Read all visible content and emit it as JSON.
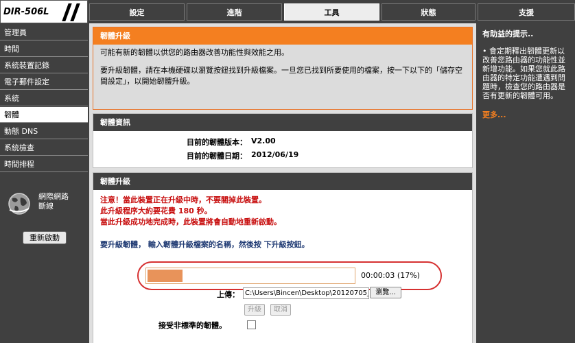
{
  "brand": {
    "model": "DIR-506L"
  },
  "nav": {
    "tabs": [
      {
        "label": "設定"
      },
      {
        "label": "進階"
      },
      {
        "label": "工具"
      },
      {
        "label": "狀態"
      },
      {
        "label": "支援"
      }
    ],
    "active_tab": "工具"
  },
  "sidebar": {
    "items": [
      {
        "label": "管理員"
      },
      {
        "label": "時間"
      },
      {
        "label": "系統裝置記錄"
      },
      {
        "label": "電子郵件設定"
      },
      {
        "label": "系統"
      },
      {
        "label": "韌體"
      },
      {
        "label": "動態 DNS"
      },
      {
        "label": "系統檢查"
      },
      {
        "label": "時間排程"
      }
    ],
    "active_item": "韌體",
    "network_status": "網際網路\n斷線",
    "network_icon": "globe-network-icon",
    "reboot_label": "重新啟動"
  },
  "intro": {
    "title": "韌體升級",
    "line1": "可能有新的韌體以供您的路由器改善功能性與效能之用。",
    "line2": "要升級韌體，請在本機硬碟以瀏覽按鈕找到升級檔案。一旦您已找到所要使用的檔案，按一下以下的「儲存空間設定」，以開始韌體升級。"
  },
  "firmware_info": {
    "title": "韌體資訊",
    "version_label": "目前的韌體版本：",
    "version_value": "V2.00",
    "date_label": "目前的韌體日期：",
    "date_value": "2012/06/19"
  },
  "upgrade": {
    "title": "韌體升級",
    "warning1": "注意！當此裝置正在升級中時，不要關掉此裝置。",
    "warning2": "此升級程序大約要花費 180 秒。",
    "warning3": "當此升級成功地完成時，此裝置將會自動地重新啟動。",
    "instruction": "要升級韌體， 輸入韌體升級檔案的名稱，然後按 下升級按鈕。",
    "progress_fraction": 0.17,
    "progress_text": "00:00:03 (17%)",
    "upload_label": "上傳：",
    "file_value": "C:\\Users\\Bincen\\Desktop\\20120705_|",
    "browse_label": "瀏覽...",
    "upgrade_button": "升級",
    "cancel_button": "取消",
    "accept_label": "接受非標準的韌體。",
    "accept_checked": false
  },
  "help": {
    "title": "有助益的提示..",
    "body": "• 會定期釋出韌體更新以改善您路由器的功能性並新增功能。如果您就此路由器的特定功能遭遇到問題時，檢查您的路由器是否有更新的韌體可用。",
    "more_label": "更多..."
  },
  "colors": {
    "accent_orange": "#f47f20",
    "dark_bg": "#404040",
    "warning_red": "#c81010",
    "instruction_blue": "#1f3a73",
    "progress_fill": "#e8935a",
    "highlight_red": "#d63030"
  }
}
